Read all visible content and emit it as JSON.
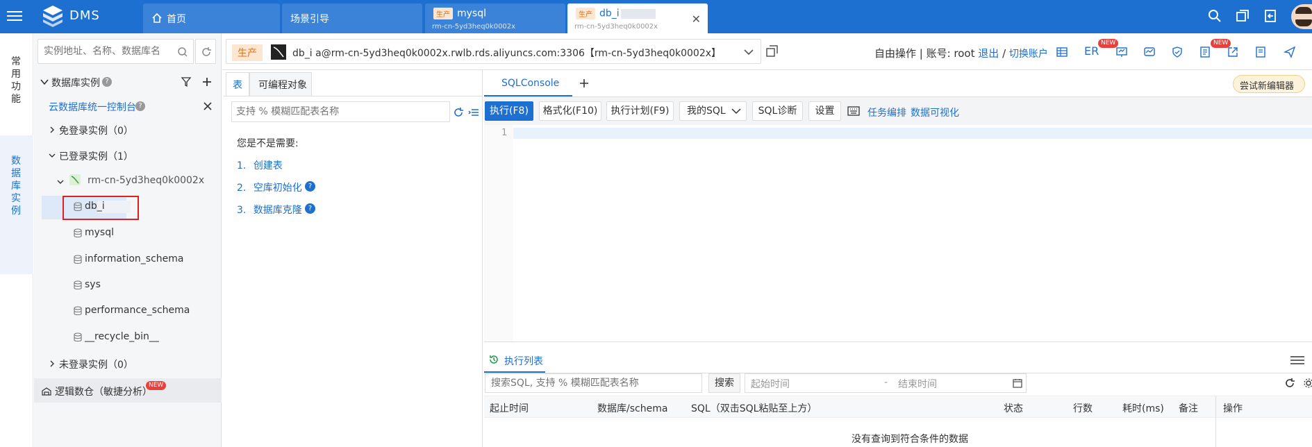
{
  "app": {
    "name": "DMS"
  },
  "tabs": [
    {
      "title": "首页"
    },
    {
      "title": "场景引导"
    },
    {
      "tag": "生产",
      "title": "mysql",
      "sub": "rm-cn-5yd3heq0k0002x"
    },
    {
      "tag": "生产",
      "title": "db_i",
      "sub": "rm-cn-5yd3heq0k0002x"
    }
  ],
  "rail": {
    "common": "常用功能",
    "instances": "数据库实例"
  },
  "sidebar": {
    "search_placeholder": "实例地址、名称、数据库名",
    "section_title": "数据库实例",
    "console_link": "云数据库统一控制台",
    "free_login": "免登录实例（0）",
    "logged_in": "已登录实例（1）",
    "instance": "rm-cn-5yd3heq0k0002x",
    "databases": [
      "db_i",
      "mysql",
      "information_schema",
      "sys",
      "performance_schema",
      "__recycle_bin__"
    ],
    "not_logged": "未登录实例（0）",
    "logic_db": "逻辑数仓（敏捷分析）",
    "new_badge": "NEW"
  },
  "connection": {
    "env": "生产",
    "text": "db_i      a@rm-cn-5yd3heq0k0002x.rwlb.rds.aliyuncs.com:3306【rm-cn-5yd3heq0k0002x】"
  },
  "header_right": {
    "mode": "自由操作 | 账号: root",
    "logout": "退出",
    "sep": "/",
    "switch": "切换账户",
    "er": "ER",
    "new1": "NEW",
    "new2": "NEW"
  },
  "midpane": {
    "tab_table": "表",
    "tab_programmable": "可编程对象",
    "search_placeholder": "支持 % 模糊匹配表名称",
    "hint": "您是不是需要:",
    "suggestions": [
      {
        "num": "1.",
        "label": "创建表"
      },
      {
        "num": "2.",
        "label": "空库初始化"
      },
      {
        "num": "3.",
        "label": "数据库克隆"
      }
    ]
  },
  "editor": {
    "tab": "SQLConsole",
    "try_new": "尝试新编辑器",
    "buttons": {
      "execute": "执行(F8)",
      "format": "格式化(F10)",
      "plan": "执行计划(F9)",
      "my_sql": "我的SQL",
      "diagnose": "SQL诊断",
      "settings": "设置"
    },
    "links": {
      "task": "任务编排",
      "visualize": "数据可视化"
    },
    "line_number": "1"
  },
  "exec_list": {
    "title": "执行列表",
    "search_placeholder": "搜索SQL, 支持 % 模糊匹配表名称",
    "search_btn": "搜索",
    "start_time": "起始时间",
    "dash": "-",
    "end_time": "结束时间",
    "columns": [
      "起止时间",
      "数据库/schema",
      "SQL（双击SQL粘贴至上方）",
      "状态",
      "行数",
      "耗时(ms)",
      "备注",
      "操作"
    ],
    "empty": "没有查询到符合条件的数据"
  },
  "colors": {
    "primary": "#1d6fd0",
    "prod_tag_bg": "#fde6cf",
    "prod_tag_fg": "#e0701a",
    "highlight_border": "#e02020"
  }
}
